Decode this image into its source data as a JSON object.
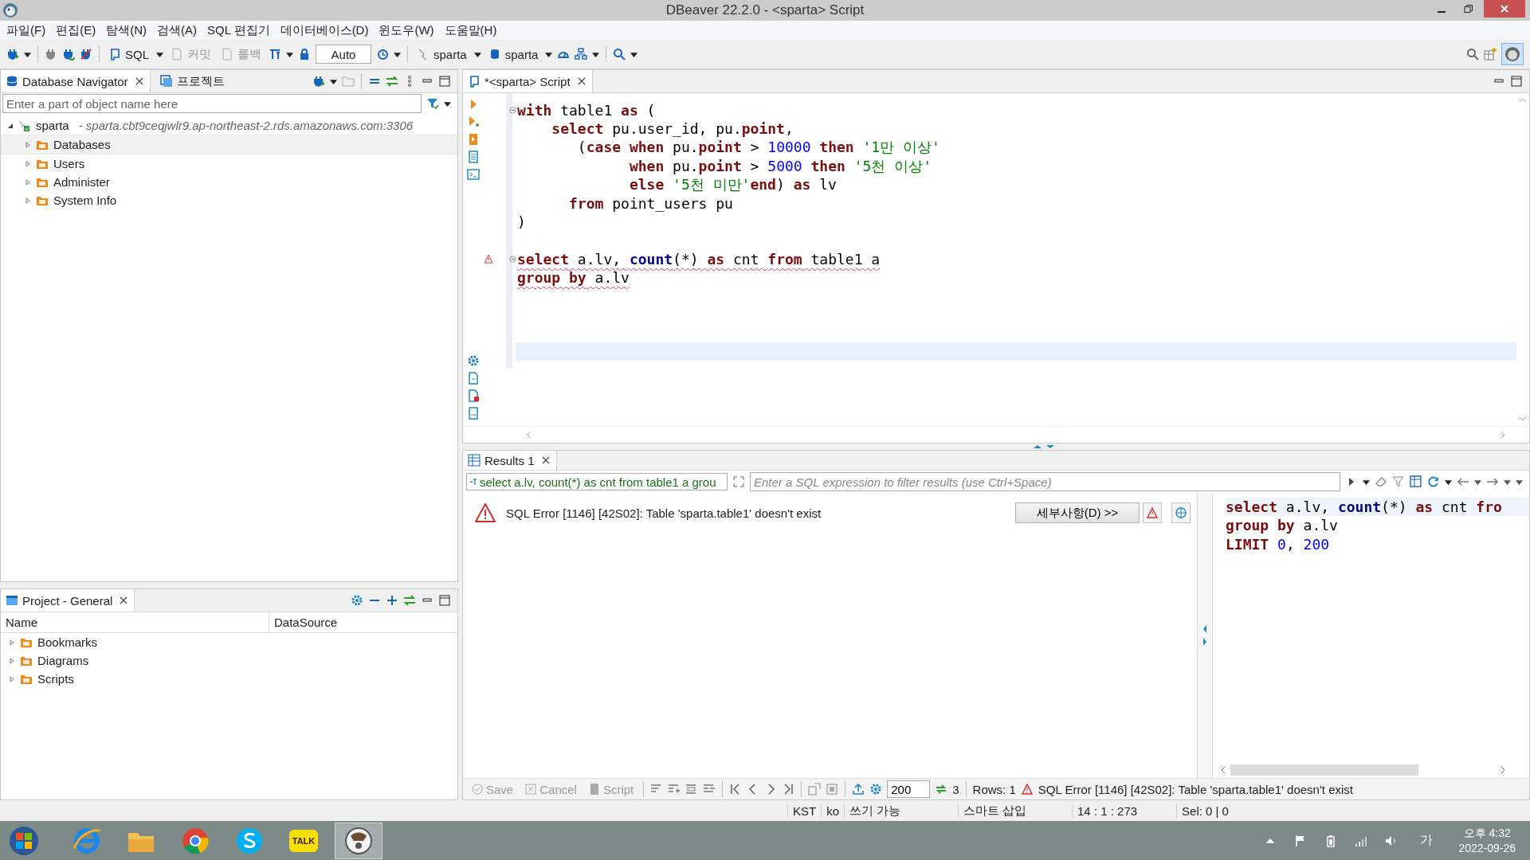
{
  "window": {
    "title": "DBeaver 22.2.0 - <sparta> Script"
  },
  "menu": [
    "파일(F)",
    "편집(E)",
    "탐색(N)",
    "검색(A)",
    "SQL 편집기",
    "데이터베이스(D)",
    "윈도우(W)",
    "도움말(H)"
  ],
  "toolbar": {
    "sql": "SQL",
    "commit": {
      "label": "커밋",
      "disabled": true
    },
    "rollback": {
      "label": "롤백",
      "disabled": true
    },
    "mode": "Auto",
    "connection": "sparta",
    "schema": "sparta"
  },
  "navigator": {
    "tabs": [
      {
        "label": "Database Navigator",
        "selected": true
      },
      {
        "label": "프로젝트",
        "selected": false
      }
    ],
    "search": {
      "placeholder": "Enter a part of object name here"
    },
    "tree": [
      {
        "label": "sparta",
        "detail": "- sparta.cbt9ceqjwlr9.ap-northeast-2.rds.amazonaws.com:3306",
        "expanded": true,
        "children": [
          {
            "label": "Databases",
            "selected": true
          },
          {
            "label": "Users",
            "selected": false
          },
          {
            "label": "Administer",
            "selected": false
          },
          {
            "label": "System Info",
            "selected": false
          }
        ]
      }
    ]
  },
  "project": {
    "title": "Project - General",
    "columns": [
      "Name",
      "DataSource"
    ],
    "items": [
      "Bookmarks",
      "Diagrams",
      "Scripts"
    ]
  },
  "editor": {
    "tab": "*<sparta> Script",
    "lines": [
      {
        "current": false,
        "fold": true,
        "tokens": [
          {
            "text": "with",
            "kind": "keyword"
          },
          {
            "text": " table1 ",
            "kind": "plain"
          },
          {
            "text": "as",
            "kind": "keyword"
          },
          {
            "text": " (",
            "kind": "plain"
          }
        ]
      },
      {
        "current": false,
        "tokens": [
          {
            "text": "    select",
            "kind": "keyword"
          },
          {
            "text": " pu.user_id, pu.",
            "kind": "plain"
          },
          {
            "text": "point",
            "kind": "keyword"
          },
          {
            "text": ",",
            "kind": "plain"
          }
        ]
      },
      {
        "current": false,
        "tokens": [
          {
            "text": "       (",
            "kind": "plain"
          },
          {
            "text": "case when",
            "kind": "keyword"
          },
          {
            "text": " pu.",
            "kind": "plain"
          },
          {
            "text": "point",
            "kind": "keyword"
          },
          {
            "text": " > ",
            "kind": "plain"
          },
          {
            "text": "10000",
            "kind": "number"
          },
          {
            "text": " then ",
            "kind": "keyword"
          },
          {
            "text": "'1만 이상'",
            "kind": "string"
          }
        ]
      },
      {
        "current": false,
        "tokens": [
          {
            "text": "             when",
            "kind": "keyword"
          },
          {
            "text": " pu.",
            "kind": "plain"
          },
          {
            "text": "point",
            "kind": "keyword"
          },
          {
            "text": " > ",
            "kind": "plain"
          },
          {
            "text": "5000",
            "kind": "number"
          },
          {
            "text": " then ",
            "kind": "keyword"
          },
          {
            "text": "'5천 이상'",
            "kind": "string"
          }
        ]
      },
      {
        "current": false,
        "tokens": [
          {
            "text": "             else ",
            "kind": "keyword"
          },
          {
            "text": "'5천 미만'",
            "kind": "string"
          },
          {
            "text": "end",
            "kind": "keyword"
          },
          {
            "text": ") ",
            "kind": "plain"
          },
          {
            "text": "as",
            "kind": "keyword"
          },
          {
            "text": " lv",
            "kind": "plain"
          }
        ]
      },
      {
        "current": false,
        "tokens": [
          {
            "text": "      from",
            "kind": "keyword"
          },
          {
            "text": " point_users pu",
            "kind": "plain"
          }
        ]
      },
      {
        "current": false,
        "tokens": [
          {
            "text": ")",
            "kind": "plain"
          }
        ]
      },
      {
        "current": false
      },
      {
        "current": false,
        "fold": true,
        "error": true,
        "error_marker": true,
        "tokens": [
          {
            "text": "select",
            "kind": "keyword"
          },
          {
            "text": " a.lv, ",
            "kind": "plain"
          },
          {
            "text": "count",
            "kind": "function"
          },
          {
            "text": "(*) ",
            "kind": "plain"
          },
          {
            "text": "as",
            "kind": "keyword"
          },
          {
            "text": " cnt ",
            "kind": "plain"
          },
          {
            "text": "from",
            "kind": "keyword"
          },
          {
            "text": " table1 a",
            "kind": "plain"
          }
        ]
      },
      {
        "current": false,
        "error": true,
        "tokens": [
          {
            "text": "group by",
            "kind": "keyword"
          },
          {
            "text": " a.lv",
            "kind": "plain"
          }
        ]
      },
      {
        "current": false
      },
      {
        "current": false
      },
      {
        "current": false
      },
      {
        "current": true
      }
    ]
  },
  "results": {
    "tab": "Results 1",
    "query": "select a.lv, count(*) as cnt from table1 a grou",
    "filter": {
      "placeholder": "Enter a SQL expression to filter results (use Ctrl+Space)"
    },
    "error": "SQL Error [1146] [42S02]: Table 'sparta.table1' doesn't exist",
    "details_button": "세부사항(D) >>",
    "preview": [
      {
        "tokens": [
          {
            "text": "select",
            "kind": "keyword"
          },
          {
            "text": " a.lv, ",
            "kind": "plain"
          },
          {
            "text": "count",
            "kind": "function"
          },
          {
            "text": "(*) ",
            "kind": "plain"
          },
          {
            "text": "as",
            "kind": "keyword"
          },
          {
            "text": " cnt ",
            "kind": "plain"
          },
          {
            "text": "fro",
            "kind": "keyword"
          }
        ]
      },
      {
        "tokens": [
          {
            "text": "group by",
            "kind": "keyword"
          },
          {
            "text": " a.lv",
            "kind": "plain"
          }
        ]
      },
      {
        "tokens": [
          {
            "text": "LIMIT ",
            "kind": "keyword"
          },
          {
            "text": "0",
            "kind": "number"
          },
          {
            "text": ", ",
            "kind": "plain"
          },
          {
            "text": "200",
            "kind": "number"
          }
        ]
      }
    ],
    "footer": {
      "buttons": [
        {
          "label": "Save",
          "disabled": true
        },
        {
          "label": "Cancel",
          "disabled": true
        },
        {
          "label": "Script",
          "disabled": true
        }
      ],
      "limit": "200",
      "fetch_count": "3",
      "rows": "Rows: 1",
      "message": "SQL Error [1146] [42S02]: Table 'sparta.table1' doesn't exist"
    }
  },
  "status_bar": [
    "KST",
    "ko",
    "쓰기 가능",
    "스마트 삽입",
    "14 : 1 : 273",
    "Sel: 0 | 0"
  ],
  "taskbar": {
    "apps": [
      {
        "kind": "ie",
        "selected": false
      },
      {
        "kind": "folder",
        "selected": false
      },
      {
        "kind": "chrome",
        "selected": false
      },
      {
        "kind": "skype",
        "selected": false
      },
      {
        "kind": "talk",
        "label": "TALK",
        "selected": false
      },
      {
        "kind": "dbeaver",
        "selected": true
      }
    ],
    "ime": "가",
    "time": "오후 4:32",
    "date": "2022-09-26"
  }
}
